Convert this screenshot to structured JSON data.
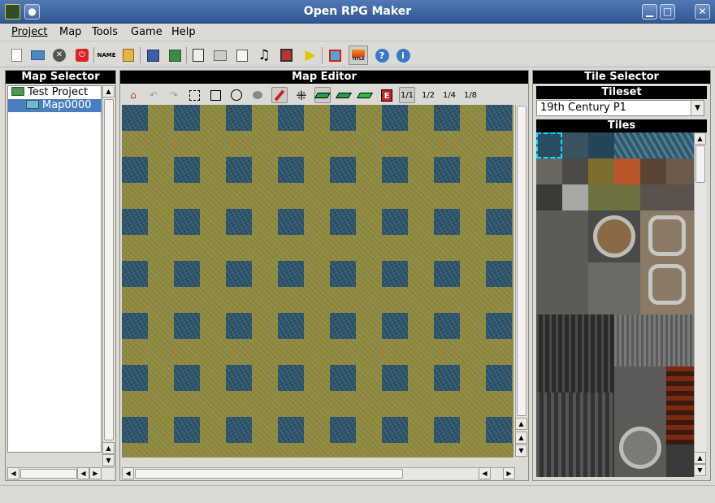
{
  "window": {
    "title": "Open RPG Maker",
    "minimize": "▁",
    "maximize": "□",
    "close": "✕"
  },
  "menu": [
    {
      "label": "Project",
      "mnemonic": "P"
    },
    {
      "label": "Map",
      "mnemonic": "M"
    },
    {
      "label": "Tools",
      "mnemonic": "T"
    },
    {
      "label": "Game",
      "mnemonic": "G"
    },
    {
      "label": "Help",
      "mnemonic": "H"
    }
  ],
  "toolbar": {
    "name_label": "NAME",
    "title_label": "TITLE",
    "music_glyph": "♫",
    "play_glyph": "▶",
    "help_glyph": "?",
    "info_glyph": "i"
  },
  "map_selector": {
    "heading": "Map Selector",
    "tree": [
      {
        "label": "Test Project",
        "level": 0,
        "selected": false
      },
      {
        "label": "Map0000",
        "level": 1,
        "selected": true
      }
    ]
  },
  "map_editor": {
    "heading": "Map Editor",
    "zoom_labels": [
      "1/1",
      "1/2",
      "1/4",
      "1/8"
    ],
    "event_label": "E"
  },
  "tile_selector": {
    "heading": "Tile Selector",
    "tileset_heading": "Tileset",
    "tileset_value": "19th Century P1",
    "tiles_heading": "Tiles"
  },
  "colors": {
    "titlebar": "#3b64a0",
    "selection": "#4b7ec1",
    "grass": "#8e8a3e",
    "water": "#2e5770",
    "tile_cursor": "#00e5ff"
  }
}
